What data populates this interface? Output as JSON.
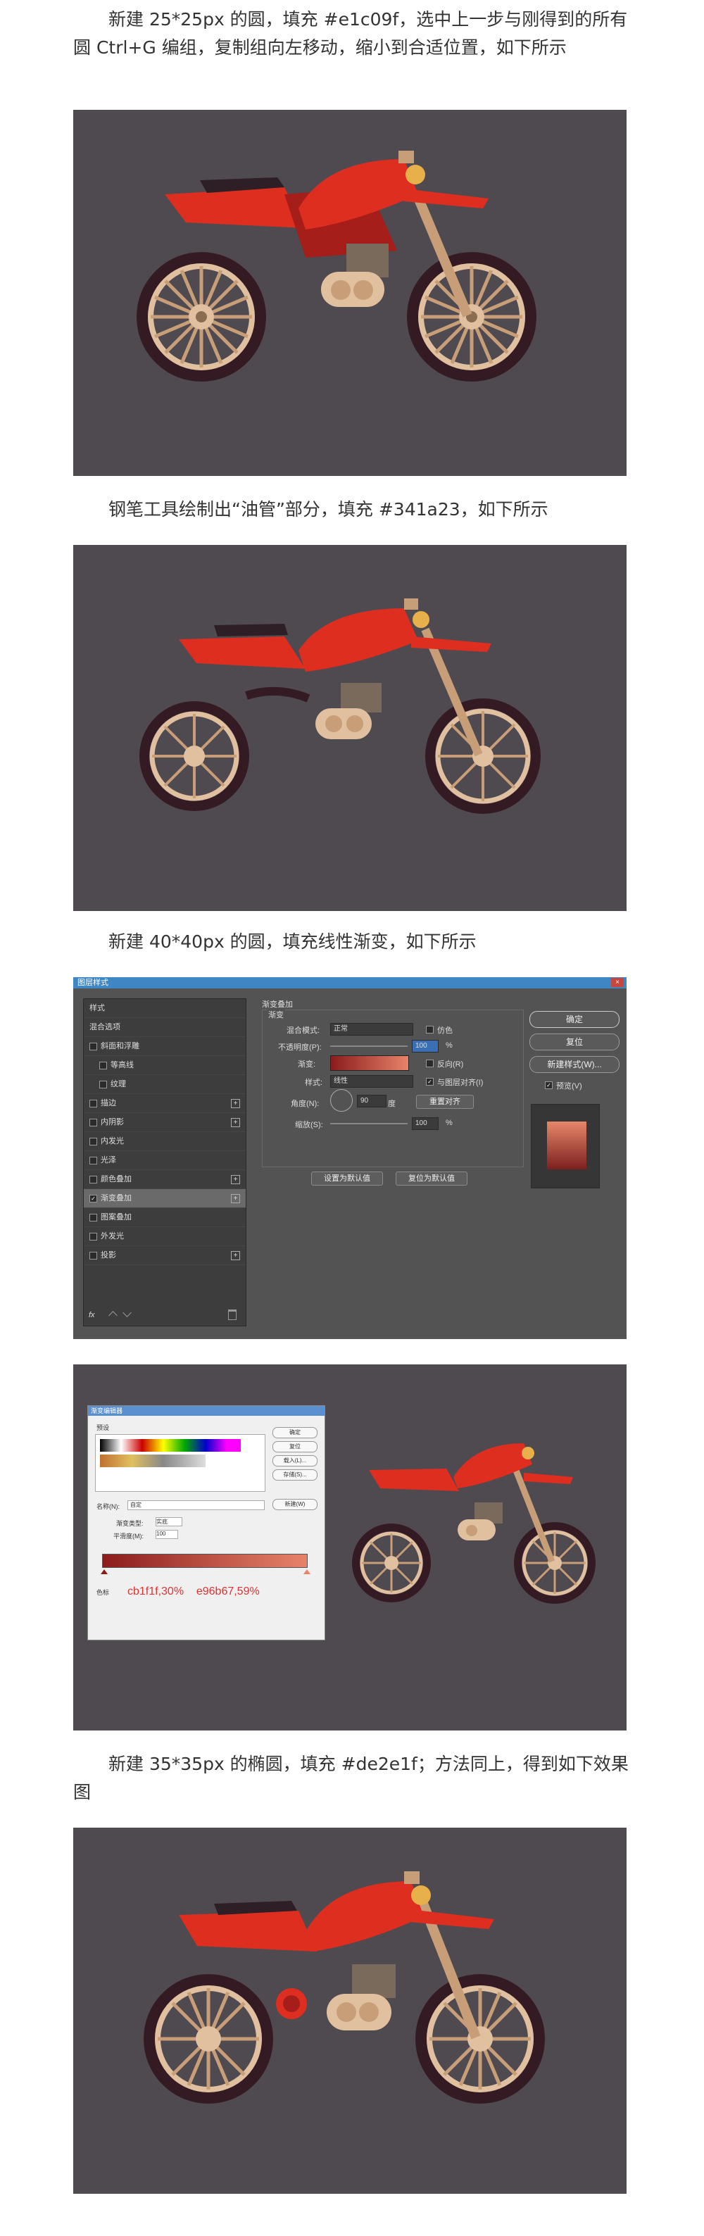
{
  "paragraphs": {
    "p1": "新建 25*25px 的圆，填充 #e1c09f，选中上一步与刚得到的所有圆 Ctrl+G 编组，复制组向左移动，缩小到合适位置，如下所示",
    "p2": "钢笔工具绘制出“油管”部分，填充 #341a23，如下所示",
    "p3": "新建 40*40px 的圆，填充线性渐变，如下所示",
    "p4": "新建 35*35px 的椭圆，填充 #de2e1f；方法同上，得到如下效果图"
  },
  "colors": {
    "panel_bg": "#4f4950",
    "tank_red": "#de2e1f",
    "dark_red": "#a51e1a",
    "seat_dark": "#2e1e26",
    "tire": "#341a23",
    "rim": "#e1c09f",
    "spoke": "#c79e78",
    "fork": "#c79e78",
    "engine": "#7a6a5c"
  },
  "ps_dialog": {
    "title": "图层样式",
    "close": "×",
    "left_items": [
      {
        "label": "样式",
        "checked": false,
        "plus": false,
        "indent": 0,
        "checkbox": false
      },
      {
        "label": "混合选项",
        "checked": false,
        "plus": false,
        "indent": 0,
        "checkbox": false
      },
      {
        "label": "斜面和浮雕",
        "checked": false,
        "plus": false,
        "indent": 0,
        "checkbox": true
      },
      {
        "label": "等高线",
        "checked": false,
        "plus": false,
        "indent": 1,
        "checkbox": true
      },
      {
        "label": "纹理",
        "checked": false,
        "plus": false,
        "indent": 1,
        "checkbox": true
      },
      {
        "label": "描边",
        "checked": false,
        "plus": true,
        "indent": 0,
        "checkbox": true
      },
      {
        "label": "内阴影",
        "checked": false,
        "plus": true,
        "indent": 0,
        "checkbox": true
      },
      {
        "label": "内发光",
        "checked": false,
        "plus": false,
        "indent": 0,
        "checkbox": true
      },
      {
        "label": "光泽",
        "checked": false,
        "plus": false,
        "indent": 0,
        "checkbox": true
      },
      {
        "label": "颜色叠加",
        "checked": false,
        "plus": true,
        "indent": 0,
        "checkbox": true
      },
      {
        "label": "渐变叠加",
        "checked": true,
        "plus": true,
        "indent": 0,
        "checkbox": true
      },
      {
        "label": "图案叠加",
        "checked": false,
        "plus": false,
        "indent": 0,
        "checkbox": true
      },
      {
        "label": "外发光",
        "checked": false,
        "plus": false,
        "indent": 0,
        "checkbox": true
      },
      {
        "label": "投影",
        "checked": false,
        "plus": true,
        "indent": 0,
        "checkbox": true
      }
    ],
    "fx_label": "fx",
    "section_title": "渐变叠加",
    "subsection": "渐变",
    "blend_mode_label": "混合模式:",
    "blend_mode_value": "正常",
    "dither_label": "仿色",
    "opacity_label": "不透明度(P):",
    "opacity_value": "100",
    "percent": "%",
    "gradient_label": "渐变:",
    "reverse_label": "反向(R)",
    "style_label": "样式:",
    "style_value": "线性",
    "align_label": "与图层对齐(I)",
    "angle_label": "角度(N):",
    "angle_value": "90",
    "degree": "度",
    "reset_align": "重置对齐",
    "scale_label": "缩放(S):",
    "scale_value": "100",
    "set_default": "设置为默认值",
    "reset_default": "复位为默认值",
    "ok": "确定",
    "reset": "复位",
    "new_style": "新建样式(W)...",
    "preview_label": "预览(V)"
  },
  "gradient_editor": {
    "title": "渐变编辑器",
    "presets_label": "预设",
    "ok": "确定",
    "reset": "复位",
    "load": "载入(L)...",
    "save": "存储(S)...",
    "name_label": "名称(N):",
    "name_value": "自定",
    "new_btn": "新建(W)",
    "type_label": "渐变类型:",
    "type_value": "实底",
    "smooth_label": "平滑度(M):",
    "smooth_value": "100",
    "stops_label": "色标",
    "stop_left_value": "cb1f1f,30%",
    "stop_right_value": "e96b67,59%"
  }
}
